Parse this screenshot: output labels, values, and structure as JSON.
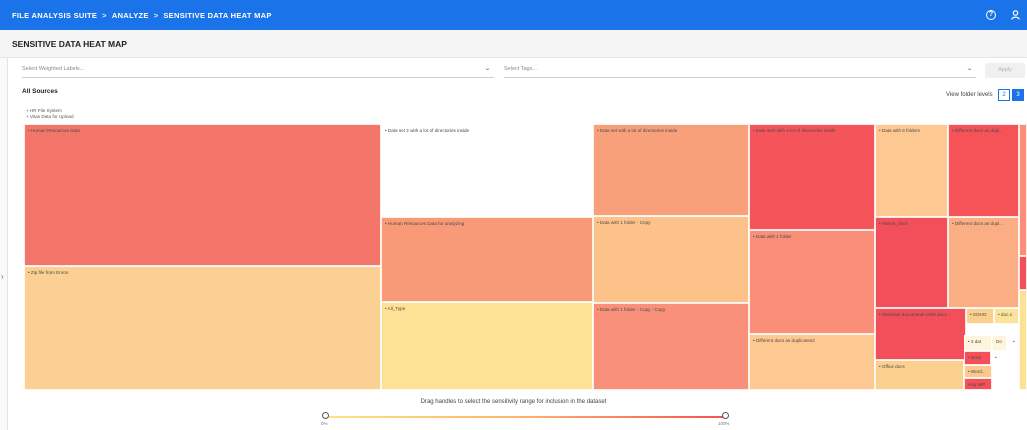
{
  "breadcrumb": {
    "items": [
      "FILE ANALYSIS SUITE",
      "ANALYZE",
      "SENSITIVE DATA HEAT MAP"
    ],
    "separator": ">"
  },
  "header": {
    "help_icon": "help-circle-icon",
    "user_icon": "user-icon"
  },
  "page": {
    "title": "SENSITIVE DATA HEAT MAP",
    "brand_color": "#1a73e8"
  },
  "filters": {
    "labels_placeholder": "Select Weighted Labels...",
    "tags_placeholder": "Select Tags...",
    "apply_label": "Apply"
  },
  "sources": {
    "heading": "All Sources",
    "items": [
      "+ HR File System",
      "+ Vitas Data for Upload"
    ]
  },
  "folder_levels": {
    "label": "View folder levels",
    "options": [
      "2",
      "3"
    ],
    "selected": "3"
  },
  "heatmap": {
    "tiles": [
      {
        "label": "• Human Resources Data",
        "color": "#f4756a"
      },
      {
        "label": "• Zip file from Enron",
        "color": "#fcd092"
      },
      {
        "label": "• Data set 2 with a lot of directories inside",
        "color": "#ffffff"
      },
      {
        "label": "• Human Resources Data for analyzing",
        "color": "#f89a78"
      },
      {
        "label": "• All_Type",
        "color": "#fde295"
      },
      {
        "label": "• Data set with a lot of directories inside",
        "color": "#f7a07a"
      },
      {
        "label": "• Data with 1 folder - Copy",
        "color": "#fcc28a"
      },
      {
        "label": "• Data with 1 folder - Copy - Copy",
        "color": "#f9907a"
      },
      {
        "label": "• Data set2 with a lot of directories inside",
        "color": "#f5545a"
      },
      {
        "label": "• Data with 1 folder",
        "color": "#f98f78"
      },
      {
        "label": "• Different docs as duplicates2",
        "color": "#fdc892"
      },
      {
        "label": "• Data with 6 folders",
        "color": "#fdc892"
      },
      {
        "label": "• Different docs as dupl...",
        "color": "#f55358"
      },
      {
        "label": "• Different docs as dupl...",
        "color": "#fbad84"
      },
      {
        "label": "• Parent_docs",
        "color": "#f24f5a"
      },
      {
        "label": "• Sensitive documents 1000 docs",
        "color": "#f24f5a"
      },
      {
        "label": "• SOHO",
        "color": "#fbd08e"
      },
      {
        "label": "• doc.s",
        "color": "#fde39a"
      },
      {
        "label": "• 3 dat",
        "color": "#fff4dc"
      },
      {
        "label": "Do",
        "color": "#fff4dc"
      },
      {
        "label": "•",
        "color": "#ffffff"
      },
      {
        "label": "• Docs",
        "color": "#f4505a"
      },
      {
        "label": "•",
        "color": "#ffffff"
      },
      {
        "label": "• Word...",
        "color": "#fbc98e"
      },
      {
        "label": "Hug WP",
        "color": "#f4505a"
      },
      {
        "label": "• Office docs",
        "color": "#fbd08e"
      },
      {
        "label": "",
        "color": "#f98f78"
      },
      {
        "label": "",
        "color": "#f24f5a"
      },
      {
        "label": "",
        "color": "#fde295"
      }
    ]
  },
  "slider": {
    "instruction": "Drag handles to select the sensitivity range for inclusion in the dataset",
    "min_label": "0%",
    "max_label": "100%",
    "min_value": 0,
    "max_value": 100
  }
}
